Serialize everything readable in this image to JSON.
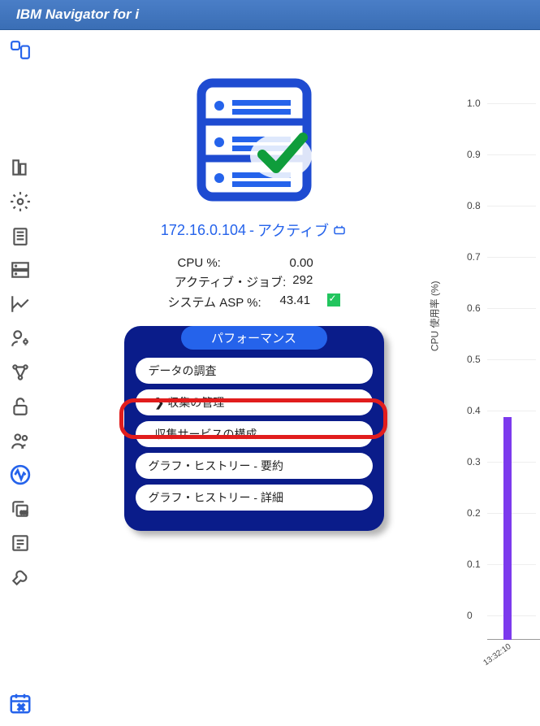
{
  "app_title": "IBM Navigator for i",
  "server": {
    "ip": "172.16.0.104",
    "status": "アクティブ"
  },
  "stats": {
    "cpu_label": "CPU %:",
    "cpu_value": "0.00",
    "jobs_label": "アクティブ・ジョブ:",
    "jobs_value": "292",
    "asp_label": "システム ASP %:",
    "asp_value": "43.41"
  },
  "performance": {
    "header": "パフォーマンス",
    "items": [
      {
        "label": "データの調査",
        "indent": false,
        "chevron": false
      },
      {
        "label": "収集の管理",
        "indent": true,
        "chevron": true
      },
      {
        "label": "収集サービスの構成",
        "indent": true,
        "chevron": false,
        "highlighted": true
      },
      {
        "label": "グラフ・ヒストリー - 要約",
        "indent": false,
        "chevron": false
      },
      {
        "label": "グラフ・ヒストリー - 詳細",
        "indent": false,
        "chevron": false
      }
    ]
  },
  "chart_data": {
    "type": "bar",
    "ylabel": "CPU 使用率 (%)",
    "ylim": [
      0,
      1.0
    ],
    "yticks": [
      0,
      0.1,
      0.2,
      0.3,
      0.4,
      0.5,
      0.6,
      0.7,
      0.8,
      0.9,
      1.0
    ],
    "categories": [
      "13:32:10"
    ],
    "values": [
      0.435
    ]
  }
}
